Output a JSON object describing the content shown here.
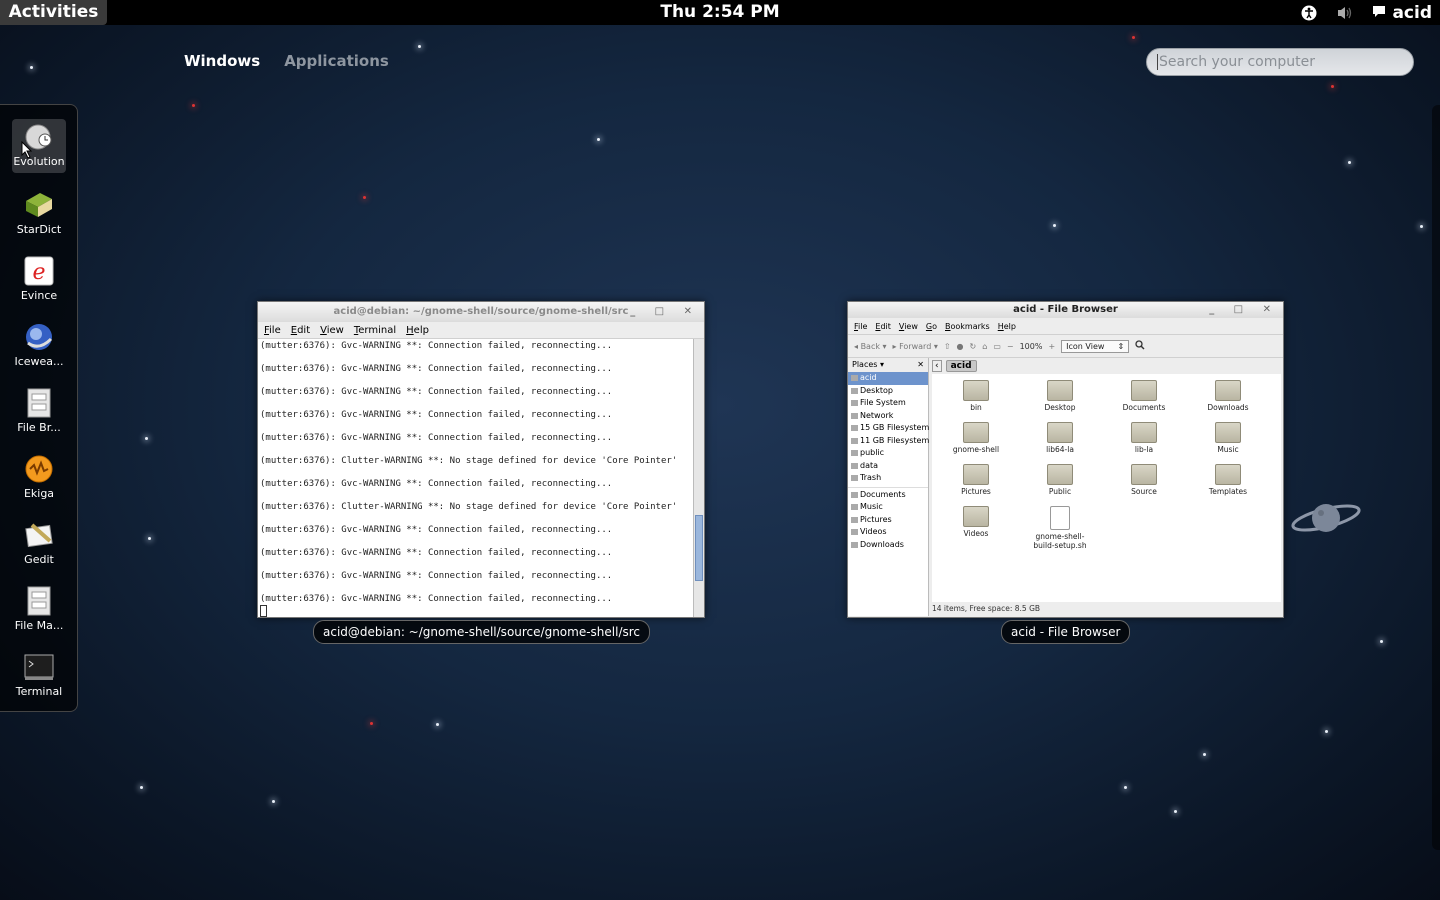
{
  "topbar": {
    "activities": "Activities",
    "clock": "Thu  2:54 PM",
    "user": "acid",
    "icons": [
      "accessibility-icon",
      "volume-icon",
      "chat-icon"
    ]
  },
  "overview": {
    "tab_windows": "Windows",
    "tab_applications": "Applications",
    "search_placeholder": "Search your computer"
  },
  "dash": {
    "items": [
      {
        "label": "Evolution",
        "icon": "evolution-icon"
      },
      {
        "label": "StarDict",
        "icon": "stardict-icon"
      },
      {
        "label": "Evince",
        "icon": "evince-icon"
      },
      {
        "label": "Icewea...",
        "icon": "iceweasel-icon"
      },
      {
        "label": "File Br...",
        "icon": "file-browser-icon"
      },
      {
        "label": "Ekiga",
        "icon": "ekiga-icon"
      },
      {
        "label": "Gedit",
        "icon": "gedit-icon"
      },
      {
        "label": "File Ma...",
        "icon": "file-manager-icon"
      },
      {
        "label": "Terminal",
        "icon": "terminal-icon"
      }
    ]
  },
  "terminal": {
    "title": "acid@debian: ~/gnome-shell/source/gnome-shell/src",
    "caption": "acid@debian: ~/gnome-shell/source/gnome-shell/src",
    "menu": [
      "File",
      "Edit",
      "View",
      "Terminal",
      "Help"
    ],
    "lines": [
      "(mutter:6376): Gvc-WARNING **: Connection failed, reconnecting...",
      "(mutter:6376): Gvc-WARNING **: Connection failed, reconnecting...",
      "(mutter:6376): Gvc-WARNING **: Connection failed, reconnecting...",
      "(mutter:6376): Gvc-WARNING **: Connection failed, reconnecting...",
      "(mutter:6376): Gvc-WARNING **: Connection failed, reconnecting...",
      "(mutter:6376): Clutter-WARNING **: No stage defined for device 'Core Pointer'",
      "(mutter:6376): Gvc-WARNING **: Connection failed, reconnecting...",
      "(mutter:6376): Clutter-WARNING **: No stage defined for device 'Core Pointer'",
      "(mutter:6376): Gvc-WARNING **: Connection failed, reconnecting...",
      "(mutter:6376): Gvc-WARNING **: Connection failed, reconnecting...",
      "(mutter:6376): Gvc-WARNING **: Connection failed, reconnecting...",
      "(mutter:6376): Gvc-WARNING **: Connection failed, reconnecting..."
    ]
  },
  "filebrowser": {
    "title": "acid - File Browser",
    "caption": "acid - File Browser",
    "menu": [
      "File",
      "Edit",
      "View",
      "Go",
      "Bookmarks",
      "Help"
    ],
    "toolbar": {
      "back": "Back",
      "forward": "Forward",
      "zoom": "100%",
      "view_mode": "Icon View"
    },
    "places_label": "Places",
    "places": [
      "acid",
      "Desktop",
      "File System",
      "Network",
      "15 GB Filesystem",
      "11 GB Filesystem",
      "public",
      "data",
      "Trash",
      "Documents",
      "Music",
      "Pictures",
      "Videos",
      "Downloads"
    ],
    "path": "acid",
    "items": [
      "bin",
      "Desktop",
      "Documents",
      "Downloads",
      "gnome-shell",
      "lib64-la",
      "lib-la",
      "Music",
      "Pictures",
      "Public",
      "Source",
      "Templates",
      "Videos",
      "gnome-shell-build-setup.sh"
    ],
    "status": "14 items, Free space: 8.5 GB"
  }
}
